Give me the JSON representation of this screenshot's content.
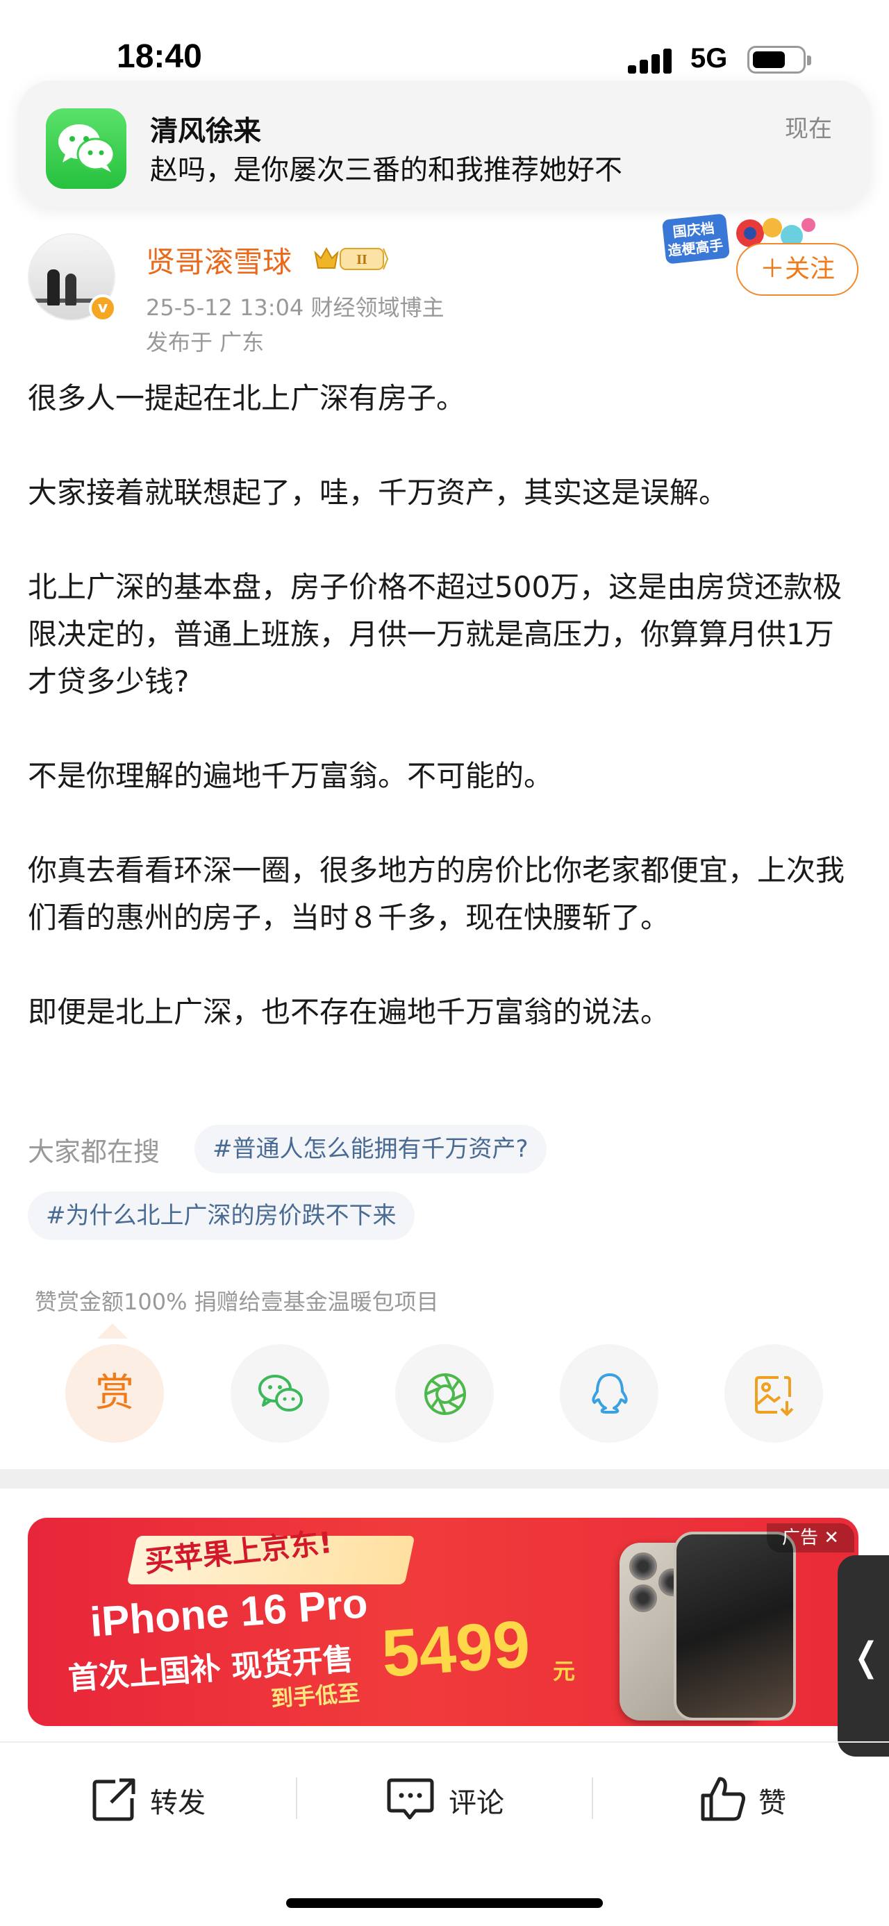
{
  "status_bar": {
    "time": "18:40",
    "network": "5G",
    "signal_bars": 4,
    "battery_level": 0.6
  },
  "notification": {
    "app_icon": "wechat-icon",
    "title": "清风徐来",
    "body": "赵吗，是你屡次三番的和我推荐她好不",
    "time": "现在"
  },
  "author": {
    "name": "贤哥滚雪球",
    "badge": "II",
    "meta": "25-5-12 13:04  财经领域博主",
    "location": "发布于 广东",
    "follow_label": "＋关注",
    "sticker_line1": "国庆档",
    "sticker_line2": "造梗高手"
  },
  "post": {
    "paragraphs": [
      "很多人一提起在北上广深有房子。",
      "大家接着就联想起了，哇，千万资产，其实这是误解。",
      "北上广深的基本盘，房子价格不超过500万，这是由房贷还款极限决定的，普通上班族，月供一万就是高压力，你算算月供1万才贷多少钱?",
      "不是你理解的遍地千万富翁。不可能的。",
      "你真去看看环深一圈，很多地方的房价比你老家都便宜，上次我们看的惠州的房子，当时８千多，现在快腰斩了。",
      "即便是北上广深，也不存在遍地千万富翁的说法。"
    ]
  },
  "hot_search": {
    "label": "大家都在搜",
    "tags": [
      "#普通人怎么能拥有千万资产?",
      "#为什么北上广深的房价跌不下来"
    ]
  },
  "donate_note": "赞赏金额100% 捐赠给壹基金温暖包项目",
  "share": {
    "reward_label": "赏",
    "icons": [
      "wechat-icon",
      "moments-icon",
      "qq-icon",
      "save-image-icon"
    ]
  },
  "ad": {
    "ribbon": "买苹果上京东!",
    "model": "iPhone 16 Pro",
    "subline": "首次上国补 现货开售",
    "price_label": "到手低至",
    "price": "5499",
    "currency": "元",
    "close_label": "广告 ✕"
  },
  "actions": {
    "repost": "转发",
    "comment": "评论",
    "like": "赞"
  },
  "colors": {
    "accent": "#f07a18",
    "tag_text": "#496a93",
    "wechat_green": "#27c13e"
  }
}
